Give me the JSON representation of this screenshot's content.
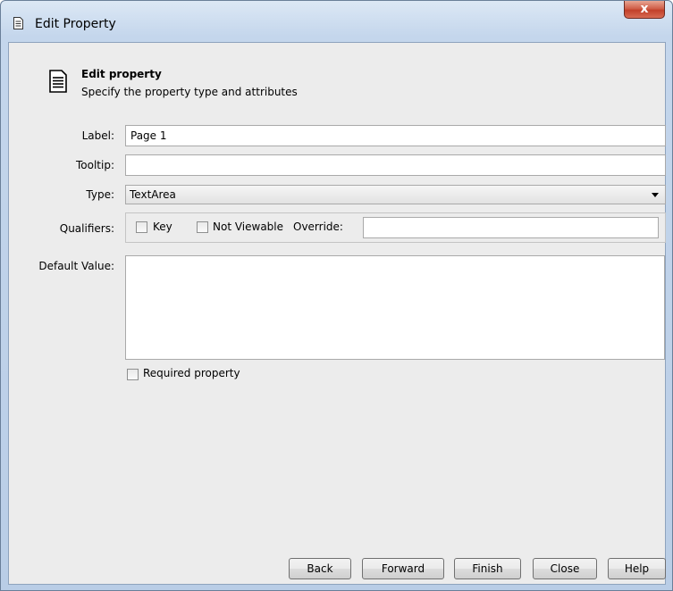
{
  "window": {
    "title": "Edit Property",
    "close_label": "x"
  },
  "header": {
    "title": "Edit property",
    "subtitle": "Specify the property type and attributes"
  },
  "form": {
    "label_label": "Label:",
    "label_value": "Page 1",
    "tooltip_label": "Tooltip:",
    "tooltip_value": "",
    "type_label": "Type:",
    "type_value": "TextArea",
    "qualifiers_label": "Qualifiers:",
    "key_label": "Key",
    "key_checked": false,
    "not_viewable_label": "Not Viewable",
    "not_viewable_checked": false,
    "override_label": "Override:",
    "override_value": "",
    "default_value_label": "Default Value:",
    "default_value": "",
    "required_label": "Required property",
    "required_checked": false
  },
  "buttons": {
    "back": "Back",
    "forward": "Forward",
    "finish": "Finish",
    "close": "Close",
    "help": "Help"
  },
  "icons": {
    "title": "document-icon",
    "header": "document-icon"
  },
  "colors": {
    "titlebar": "#c4d6ec",
    "close_button": "#c2402a",
    "panel": "#ececec"
  }
}
